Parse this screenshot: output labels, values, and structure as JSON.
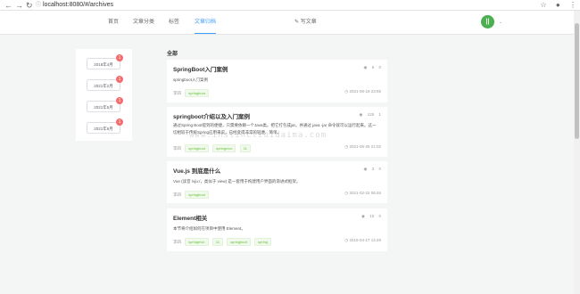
{
  "browser": {
    "back": "←",
    "forward": "→",
    "reload": "↻",
    "lock": "ⓘ",
    "url": "localhost:8080/#/archives",
    "star": "☆",
    "profile": "●",
    "more": "⋮"
  },
  "header": {
    "menu": [
      "首页",
      "文章分类",
      "标签",
      "文章归档"
    ],
    "active_index": 3,
    "write_icon": "✎",
    "write_label": "写文章",
    "avatar_text": "||",
    "avatar_caret": "⌄"
  },
  "archives": [
    {
      "label": "2018年4月",
      "count": "1"
    },
    {
      "label": "2021年2月",
      "count": "1"
    },
    {
      "label": "2021年5月",
      "count": "1"
    },
    {
      "label": "2021年6月",
      "count": "1"
    }
  ],
  "section_title": "全部",
  "articles": [
    {
      "title": "SpringBoot入门案例",
      "views": "6",
      "comments": "0",
      "summary": "springboot入门案例",
      "author": "李四",
      "tags": [
        "springboot"
      ],
      "time": "2021-06-18 23:55"
    },
    {
      "title": "springboot介绍以及入门案例",
      "views": "125",
      "comments": "1",
      "summary": "通过Spring Boot提到的便捷，只需要依赖一个Java类。把它打包成jar。并通过 java -jar 命令就可以运行起来。这一切相较于传统Spring应用来说，已经变得非常的轻便、简单。",
      "author": "李四",
      "tags": [
        "springboot",
        "springmvc",
        "11"
      ],
      "time": "2021-05-25 21:02"
    },
    {
      "title": "Vue.js 到底是什么",
      "views": "3",
      "comments": "0",
      "summary": "Vue (读音 /vjuː/，类似于 view) 是一套用于构建用户界面的渐进式框架。",
      "author": "李四",
      "tags": [
        "springboot"
      ],
      "time": "2021-02-22 06:46"
    },
    {
      "title": "Element相关",
      "views": "10",
      "comments": "0",
      "summary": "本节将介绍如何在项目中使用 Element。",
      "author": "李四",
      "tags": [
        "springmvc",
        "11",
        "springboot",
        "spring"
      ],
      "time": "2018-04-17 14:49"
    }
  ],
  "watermark": "www.instinctzuidaima.com",
  "colors": {
    "accent": "#409eff",
    "tag_green": "#67c23a",
    "badge_red": "#f56c6c",
    "avatar_green": "#4caf50"
  }
}
